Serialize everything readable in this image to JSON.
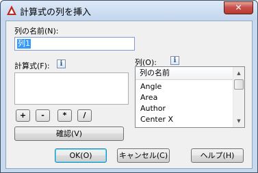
{
  "window": {
    "title": "計算式の列を挿入",
    "close_glyph": "✕",
    "accent": "#c0271c"
  },
  "name_field": {
    "label": "列の名前(N):",
    "value": "列1"
  },
  "formula": {
    "label": "計算式(F):",
    "info": "i",
    "operators": [
      "+",
      "-",
      "*",
      "/"
    ],
    "verify_button": "確認(V)"
  },
  "columns": {
    "label": "列(O):",
    "info": "i",
    "header": "列の名前",
    "items": [
      "Angle",
      "Area",
      "Author",
      "Center X"
    ]
  },
  "footer": {
    "ok": "OK(O)",
    "cancel": "キャンセル(C)",
    "help": "ヘルプ(H)"
  }
}
